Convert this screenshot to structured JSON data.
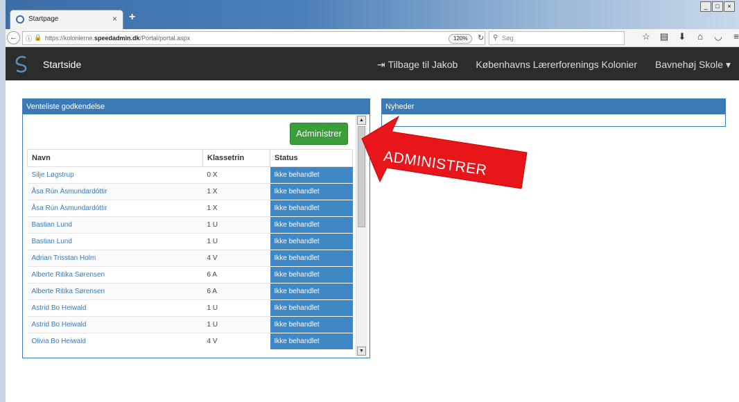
{
  "browser": {
    "tab_title": "Startpage",
    "url_prefix": "https://kolonierne.",
    "url_domain": "speedadmin.dk",
    "url_path": "/Portal/portal.aspx",
    "zoom": "120%",
    "search_placeholder": "Søg"
  },
  "app": {
    "brand": "Startside",
    "back_link": "Tilbage til Jakob",
    "org_link": "Københavns Lærerforenings Kolonier",
    "school_menu": "Bavnehøj Skole",
    "caret": "▾"
  },
  "venteliste": {
    "title": "Venteliste godkendelse",
    "admin_button": "Administrer",
    "columns": [
      "Navn",
      "Klassetrin",
      "Status"
    ],
    "rows": [
      {
        "name": "Silje Løgstrup",
        "grade": "0 X",
        "status": "Ikke behandlet"
      },
      {
        "name": "Åsa Rún Àsmundardóttir",
        "grade": "1 X",
        "status": "Ikke behandlet"
      },
      {
        "name": "Åsa Rún Àsmundardóttir",
        "grade": "1 X",
        "status": "Ikke behandlet"
      },
      {
        "name": "Bastian Lund",
        "grade": "1 U",
        "status": "Ikke behandlet"
      },
      {
        "name": "Bastian Lund",
        "grade": "1 U",
        "status": "Ikke behandlet"
      },
      {
        "name": "Adrian Trisstan Holm",
        "grade": "4 V",
        "status": "Ikke behandlet"
      },
      {
        "name": "Alberte Ritika Sørensen",
        "grade": "6 A",
        "status": "Ikke behandlet"
      },
      {
        "name": "Alberte Ritika Sørensen",
        "grade": "6 A",
        "status": "Ikke behandlet"
      },
      {
        "name": "Astrid Bo Heiwald",
        "grade": "1 U",
        "status": "Ikke behandlet"
      },
      {
        "name": "Astrid Bo Heiwald",
        "grade": "1 U",
        "status": "Ikke behandlet"
      },
      {
        "name": "Olivia Bo Heiwald",
        "grade": "4 V",
        "status": "Ikke behandlet"
      }
    ]
  },
  "news": {
    "title": "Nyheder"
  },
  "annotation": {
    "text": "ADMINISTRER",
    "color": "#e8161b"
  },
  "colors": {
    "primary": "#3c7ab5",
    "status_cell": "#3f88c5",
    "button_green": "#3a9e3a",
    "navbar": "#2c2c2c"
  }
}
